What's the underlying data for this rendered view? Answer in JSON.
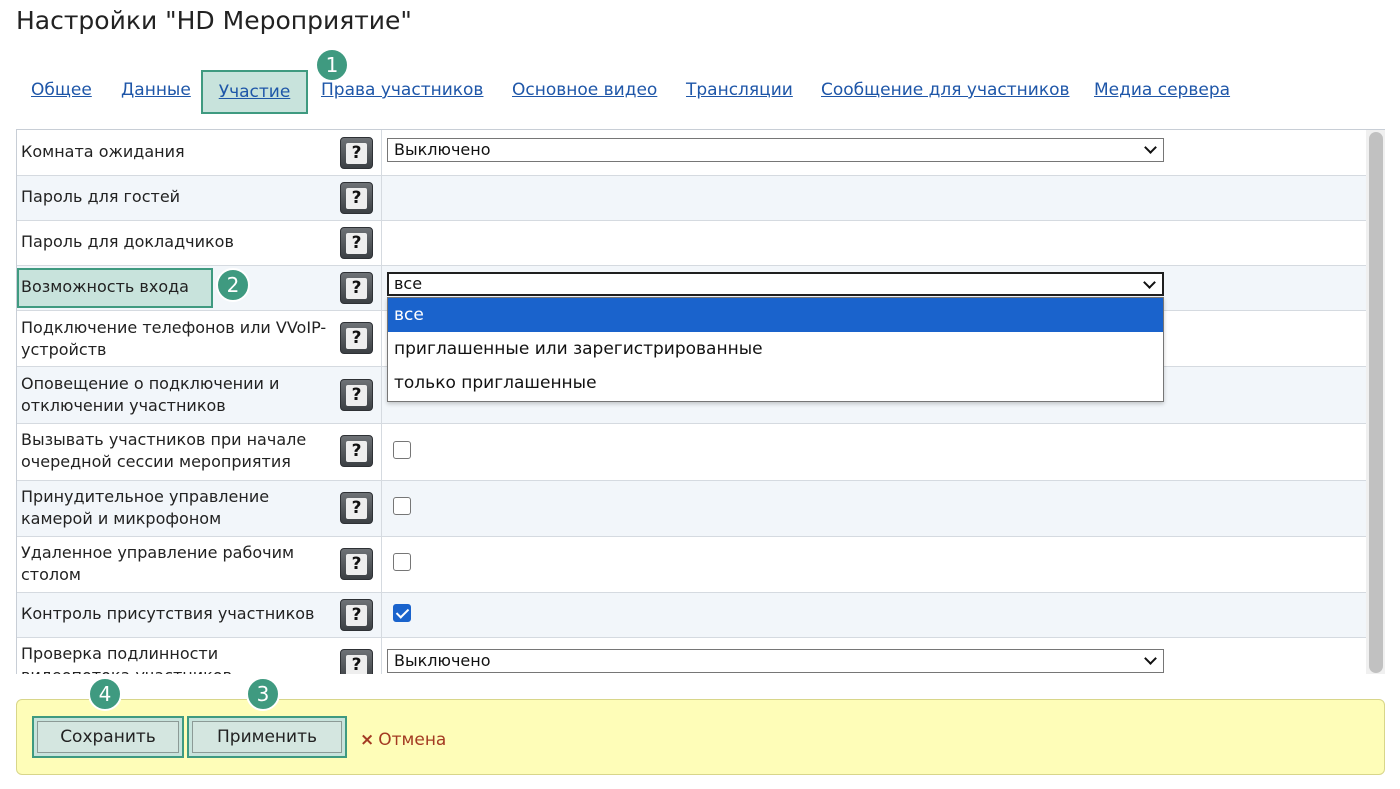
{
  "page": {
    "title": "Настройки \"HD Мероприятие\""
  },
  "tabs": [
    {
      "label": "Общее"
    },
    {
      "label": "Данные"
    },
    {
      "label": "Участие"
    },
    {
      "label": "Права участников"
    },
    {
      "label": "Основное видео"
    },
    {
      "label": "Трансляции"
    },
    {
      "label": "Сообщение для участников"
    },
    {
      "label": "Медиа сервера"
    }
  ],
  "badges": {
    "b1": "1",
    "b2": "2",
    "b3": "3",
    "b4": "4"
  },
  "help_icon_glyph": "?",
  "rows": [
    {
      "label": "Комната ожидания",
      "value": "Выключено"
    },
    {
      "label": "Пароль для гостей"
    },
    {
      "label": "Пароль для докладчиков"
    },
    {
      "label": "Возможность входа",
      "value": "все"
    },
    {
      "label": "Подключение телефонов или VVoIP-устройств"
    },
    {
      "label": "Оповещение о подключении и отключении участников"
    },
    {
      "label": "Вызывать участников при начале очередной сессии мероприятия",
      "checked": false
    },
    {
      "label": "Принудительное управление камерой и микрофоном",
      "checked": false
    },
    {
      "label": "Удаленное управление рабочим столом",
      "checked": false
    },
    {
      "label": "Контроль присутствия участников",
      "checked": true
    },
    {
      "label": "Проверка подлинности видеопотока участников",
      "value": "Выключено"
    }
  ],
  "entry_options": [
    {
      "label": "все",
      "selected": true
    },
    {
      "label": "приглашенные или зарегистрированные"
    },
    {
      "label": "только приглашенные"
    }
  ],
  "footer": {
    "save_label": "Сохранить",
    "apply_label": "Применить",
    "cancel_icon": "×",
    "cancel_label": "Отмена"
  },
  "colors": {
    "accent": "#3f9a80",
    "highlight": "#c8e3dc",
    "link": "#1e56a8",
    "footer_bg": "#fefdb8",
    "cancel": "#a33a22",
    "selected": "#1a63cc"
  }
}
